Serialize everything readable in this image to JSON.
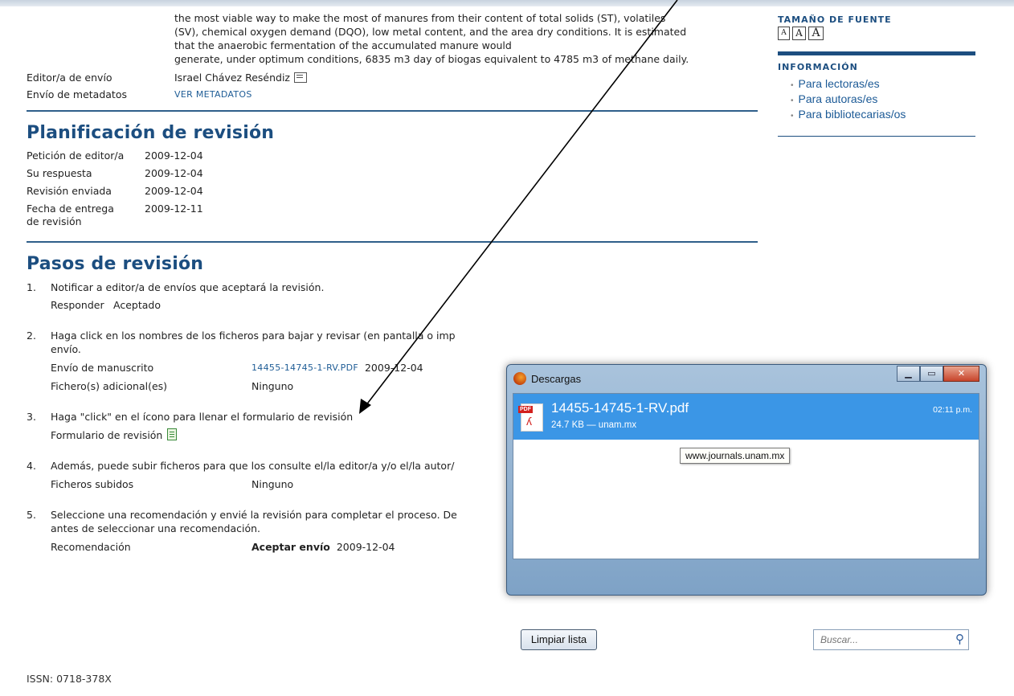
{
  "abstract_lines": [
    "the most viable way to make the most of manures from their content of total solids (ST), volatiles",
    "(SV), chemical oxygen demand (DQO), low metal content, and the area dry conditions. It is estimated",
    "that the anaerobic fermentation of the accumulated manure would",
    "generate, under optimum conditions, 6835 m3 day of biogas equivalent to 4785 m3 of methane daily."
  ],
  "meta": {
    "editor_label": "Editor/a de envío",
    "editor_value": "Israel Chávez Reséndiz",
    "metadata_label": "Envío de metadatos",
    "metadata_link": "VER METADATOS"
  },
  "schedule": {
    "title": "Planificación de revisión",
    "rows": [
      {
        "k": "Petición de editor/a",
        "v": "2009-12-04"
      },
      {
        "k": "Su respuesta",
        "v": "2009-12-04"
      },
      {
        "k": "Revisión enviada",
        "v": "2009-12-04"
      },
      {
        "k": "Fecha de entrega de revisión",
        "v": "2009-12-11"
      }
    ]
  },
  "steps": {
    "title": "Pasos de revisión",
    "s1_num": "1.",
    "s1_text": "Notificar a editor/a de envíos que aceptará la revisión.",
    "s1_sub_k": "Responder",
    "s1_sub_v": "Aceptado",
    "s2_num": "2.",
    "s2_text_a": "Haga click en los nombres de los ficheros para bajar y revisar (en pantalla o imp",
    "s2_text_b": "envío.",
    "s2_sub1_k": "Envío de manuscrito",
    "s2_sub1_link": "14455-14745-1-RV.PDF",
    "s2_sub1_date": "2009-12-04",
    "s2_sub2_k": "Fichero(s) adicional(es)",
    "s2_sub2_v": "Ninguno",
    "s3_num": "3.",
    "s3_text": "Haga \"click\" en el ícono para llenar el formulario de revisión",
    "s3_sub_k": "Formulario de revisión",
    "s4_num": "4.",
    "s4_text": "Además, puede subir ficheros para que los consulte el/la editor/a y/o el/la autor/",
    "s4_sub_k": "Ficheros subidos",
    "s4_sub_v": "Ninguno",
    "s5_num": "5.",
    "s5_text_a": "Seleccione una recomendación y envié la revisión para completar el proceso. De",
    "s5_text_b": "antes de seleccionar una recomendación.",
    "s5_sub_k": "Recomendación",
    "s5_sub_v": "Aceptar envío",
    "s5_sub_date": "2009-12-04"
  },
  "footer": {
    "issn": "ISSN: 0718-378X"
  },
  "sidebar": {
    "font_title": "TAMAÑO DE FUENTE",
    "font_sizes": [
      "A",
      "A",
      "A"
    ],
    "info_title": "INFORMACIÓN",
    "info_links": [
      "Para lectoras/es",
      "Para autoras/es",
      "Para bibliotecarias/os"
    ]
  },
  "downloads": {
    "title": "Descargas",
    "file_name": "14455-14745-1-RV.pdf",
    "file_info": "24.7 KB — unam.mx",
    "time": "02:11 p.m.",
    "tooltip": "www.journals.unam.mx",
    "clear_label": "Limpiar lista",
    "search_placeholder": "Buscar..."
  }
}
